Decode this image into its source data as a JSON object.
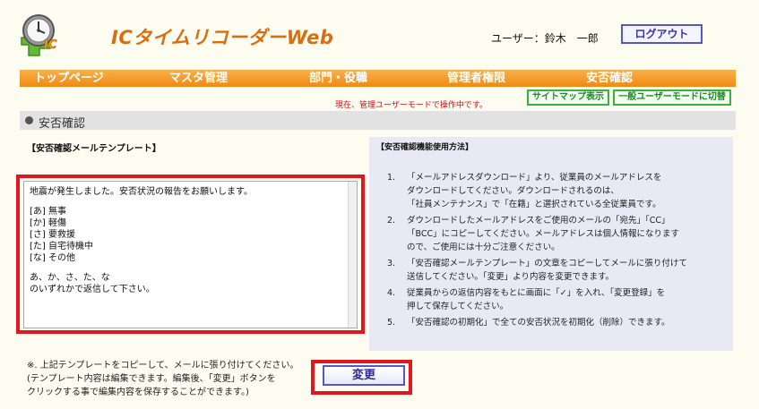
{
  "header": {
    "app_title": "ICタイムリコーダーWeb",
    "user_label": "ユーザー：鈴木　一郎",
    "logout_label": "ログアウト",
    "logo_icon": "clock-ic-logo-icon"
  },
  "nav": {
    "items": [
      {
        "label": "トップページ"
      },
      {
        "label": "マスタ管理"
      },
      {
        "label": "部門・役職"
      },
      {
        "label": "管理者権限"
      },
      {
        "label": "安否確認"
      }
    ]
  },
  "mode_message": "現在、管理ユーザーモードで操作中です。",
  "sitemap_button": "サイトマップ表示",
  "switch_button": "一般ユーザーモードに切替",
  "section": {
    "title": "安否確認"
  },
  "template": {
    "title": "【安否確認メールテンプレート】",
    "lines": {
      "l1": "地震が発生しました。安否状況の報告をお願いします。",
      "l2": "[あ] 無事",
      "l3": "[か] 軽傷",
      "l4": "[さ] 要救援",
      "l5": "[た] 自宅待機中",
      "l6": "[な] その他",
      "l7": "あ、か、さ、た、な",
      "l8": "のいずれかで返信して下さい。"
    }
  },
  "help": {
    "title": "【安否確認機能使用方法】",
    "items": [
      {
        "num": "1.",
        "lines": [
          "「メールアドレスダウンロード」より、従業員のメールアドレスを",
          "ダウンロードしてください。ダウンロードされるのは、",
          "「社員メンテナンス」で「在籍」と選択されている全従業員です。"
        ]
      },
      {
        "num": "2.",
        "lines": [
          "ダウンロードしたメールアドレスをご使用のメールの「宛先」「CC」",
          "「BCC」にコピーしてください。メールアドレスは個人情報になります",
          "ので、ご使用には十分ご注意ください。"
        ]
      },
      {
        "num": "3.",
        "lines": [
          "「安否確認メールテンプレート」の文章をコピーしてメールに張り付けて",
          "送信してください。「変更」より内容を変更できます。"
        ]
      },
      {
        "num": "4.",
        "lines": [
          "従業員からの返信内容をもとに画面に「✓」を入れ、「変更登録」を",
          "押して保存してください。"
        ]
      },
      {
        "num": "5.",
        "lines": [
          "「安否確認の初期化」で全ての安否状況を初期化（削除）できます。"
        ]
      }
    ]
  },
  "note": {
    "line1": "※. 上記テンプレートをコピーして、メールに張り付けてください。",
    "line2": "(テンプレート内容は編集できます。編集後、「変更」ボタンを",
    "line3": "クリックする事で編集内容を保存することができます。)"
  },
  "submit_button": "変更",
  "colors": {
    "accent_orange": "#ef8a13",
    "highlight_red": "#e2161f",
    "button_border": "#5656c8",
    "mode_message_red": "#c8101b",
    "green_button": "#3ab040"
  }
}
